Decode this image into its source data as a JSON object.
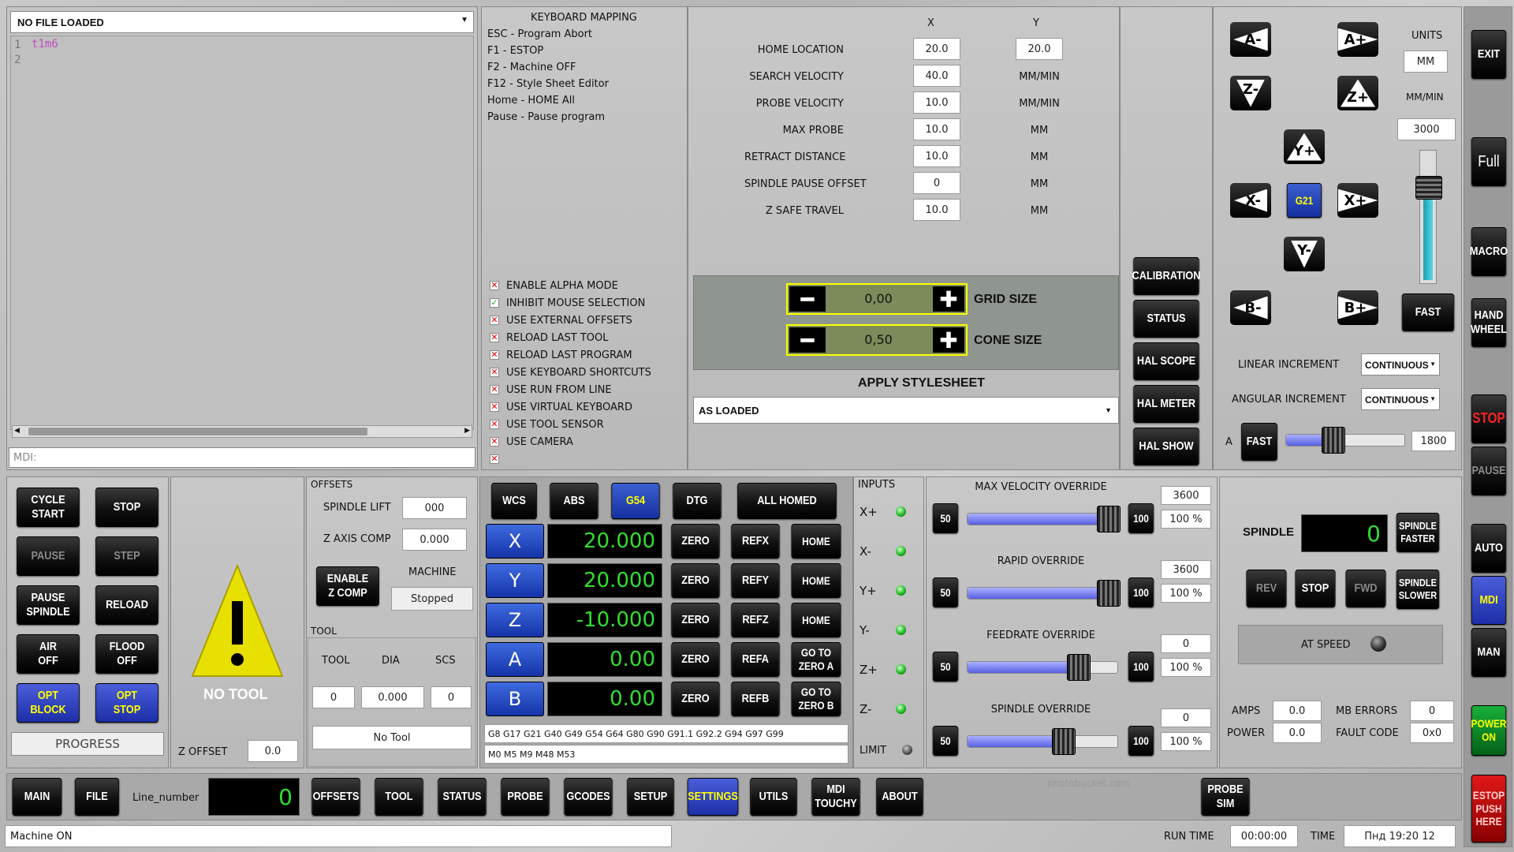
{
  "editor": {
    "file": "NO FILE LOADED",
    "lines": [
      "1",
      "2"
    ],
    "code": "t1m6",
    "mdi_placeholder": "MDI:"
  },
  "keymap": {
    "title": "KEYBOARD MAPPING",
    "items": [
      "ESC - Program Abort",
      "F1 - ESTOP",
      "F2 - Machine OFF",
      "F12 - Style Sheet Editor",
      "Home - HOME All",
      "Pause - Pause program"
    ]
  },
  "options": [
    {
      "label": "ENABLE ALPHA MODE",
      "checked": false
    },
    {
      "label": "INHIBIT MOUSE SELECTION",
      "checked": true
    },
    {
      "label": "USE EXTERNAL OFFSETS",
      "checked": false
    },
    {
      "label": "RELOAD LAST TOOL",
      "checked": false
    },
    {
      "label": "RELOAD LAST PROGRAM",
      "checked": false
    },
    {
      "label": "USE KEYBOARD SHORTCUTS",
      "checked": false
    },
    {
      "label": "USE RUN FROM LINE",
      "checked": false
    },
    {
      "label": "USE VIRTUAL KEYBOARD",
      "checked": false
    },
    {
      "label": "USE TOOL SENSOR",
      "checked": false
    },
    {
      "label": "USE CAMERA",
      "checked": false
    },
    {
      "label": "",
      "checked": false
    }
  ],
  "probe": {
    "col_x": "X",
    "col_y": "Y",
    "rows": [
      {
        "label": "HOME LOCATION",
        "x": "20.0",
        "y": "20.0",
        "unit": ""
      },
      {
        "label": "SEARCH VELOCITY",
        "x": "40.0",
        "y": "",
        "unit": "MM/MIN"
      },
      {
        "label": "PROBE VELOCITY",
        "x": "10.0",
        "y": "",
        "unit": "MM/MIN"
      },
      {
        "label": "MAX PROBE",
        "x": "10.0",
        "y": "",
        "unit": "MM"
      },
      {
        "label": "RETRACT DISTANCE",
        "x": "10.0",
        "y": "",
        "unit": "MM"
      },
      {
        "label": "SPINDLE PAUSE OFFSET",
        "x": "0",
        "y": "",
        "unit": "MM"
      },
      {
        "label": "Z SAFE TRAVEL",
        "x": "10.0",
        "y": "",
        "unit": "MM"
      }
    ]
  },
  "grid": {
    "grid_value": "0,00",
    "grid_label": "GRID SIZE",
    "cone_value": "0,50",
    "cone_label": "CONE SIZE",
    "stylesheet_label": "APPLY STYLESHEET",
    "stylesheet_value": "AS LOADED"
  },
  "utilbtns": [
    "CALIBRATION",
    "STATUS",
    "HAL SCOPE",
    "HAL METER",
    "HAL SHOW"
  ],
  "jog": {
    "units_label": "UNITS",
    "units": "MM",
    "rate_label": "MM/MIN",
    "rate": "3000",
    "g21": "G21",
    "fast": "FAST",
    "lin_label": "LINEAR INCREMENT",
    "lin": "CONTINUOUS",
    "ang_label": "ANGULAR INCREMENT",
    "ang": "CONTINUOUS",
    "a_label": "A",
    "a_fast": "FAST",
    "a_rate": "1800",
    "a_rate_frac": 0.4,
    "rate_frac": 0.75,
    "keys": {
      "am": "A-",
      "ap": "A+",
      "zm": "Z-",
      "zp": "Z+",
      "yp": "Y+",
      "xm": "X-",
      "xp": "X+",
      "ym": "Y-",
      "bm": "B-",
      "bp": "B+"
    }
  },
  "side": {
    "exit": "EXIT",
    "full": "Full",
    "macro": "MACRO",
    "hand": "HAND\nWHEEL",
    "stop": "STOP",
    "pause": "PAUSE",
    "auto": "AUTO",
    "mdi": "MDI",
    "man": "MAN",
    "power": "POWER\nON",
    "estop": "ESTOP\nPUSH\nHERE"
  },
  "run": {
    "cycle": "CYCLE\nSTART",
    "stop": "STOP",
    "pause": "PAUSE",
    "step": "STEP",
    "pspindle": "PAUSE\nSPINDLE",
    "reload": "RELOAD",
    "air": "AIR\nOFF",
    "flood": "FLOOD\nOFF",
    "optblock": "OPT\nBLOCK",
    "optstop": "OPT\nSTOP",
    "progress": "PROGRESS"
  },
  "tool": {
    "notool": "NO TOOL",
    "zoffset_label": "Z OFFSET",
    "zoffset": "0.0"
  },
  "offsets": {
    "title": "OFFSETS",
    "spindle_lift_label": "SPINDLE LIFT",
    "spindle_lift": "000",
    "zcomp_label": "Z AXIS COMP",
    "zcomp": "0.000",
    "enable": "ENABLE\nZ COMP",
    "machine_label": "MACHINE",
    "machine": "Stopped",
    "tool_title": "TOOL",
    "tool_h": "TOOL",
    "dia_h": "DIA",
    "scs_h": "SCS",
    "tool": "0",
    "dia": "0.000",
    "scs": "0",
    "desc": "No Tool"
  },
  "dro": {
    "wcs": "WCS",
    "abs": "ABS",
    "g54": "G54",
    "dtg": "DTG",
    "homed": "ALL HOMED",
    "axes": [
      {
        "name": "X",
        "value": "20.000",
        "ref": "REFX",
        "home": "HOME"
      },
      {
        "name": "Y",
        "value": "20.000",
        "ref": "REFY",
        "home": "HOME"
      },
      {
        "name": "Z",
        "value": "-10.000",
        "ref": "REFZ",
        "home": "HOME"
      },
      {
        "name": "A",
        "value": "0.00",
        "ref": "REFA",
        "home": "GO TO\nZERO A"
      },
      {
        "name": "B",
        "value": "0.00",
        "ref": "REFB",
        "home": "GO TO\nZERO B"
      }
    ],
    "zero": "ZERO",
    "gcodes": "G8 G17 G21 G40 G49 G54 G64 G80 G90 G91.1 G92.2 G94 G97 G99",
    "mcodes": "M0 M5 M9 M48 M53"
  },
  "inputs": {
    "title": "INPUTS",
    "items": [
      "X+",
      "X-",
      "Y+",
      "Y-",
      "Z+",
      "Z-"
    ],
    "limit": "LIMIT"
  },
  "overrides": [
    {
      "title": "MAX VELOCITY OVERRIDE",
      "value": "3600",
      "pct": "100 %",
      "frac": 1.0
    },
    {
      "title": "RAPID OVERRIDE",
      "value": "3600",
      "pct": "100 %",
      "frac": 1.0
    },
    {
      "title": "FEEDRATE OVERRIDE",
      "value": "0",
      "pct": "100 %",
      "frac": 0.8
    },
    {
      "title": "SPINDLE OVERRIDE",
      "value": "0",
      "pct": "100 %",
      "frac": 0.7
    }
  ],
  "ovr_btns": {
    "low": "50",
    "high": "100"
  },
  "spindle": {
    "label": "SPINDLE",
    "rpm": "0",
    "faster": "SPINDLE\nFASTER",
    "slower": "SPINDLE\nSLOWER",
    "rev": "REV",
    "stop": "STOP",
    "fwd": "FWD",
    "atspeed": "AT SPEED",
    "amps_label": "AMPS",
    "amps": "0.0",
    "power_label": "POWER",
    "power": "0.0",
    "mberr_label": "MB ERRORS",
    "mberr": "0",
    "fault_label": "FAULT CODE",
    "fault": "0x0"
  },
  "tabs": [
    "MAIN",
    "FILE",
    "OFFSETS",
    "TOOL",
    "STATUS",
    "PROBE",
    "GCODES",
    "SETUP",
    "SETTINGS",
    "UTILS",
    "MDI\nTOUCHY",
    "ABOUT"
  ],
  "active_tab": "SETTINGS",
  "line_number_label": "Line_number",
  "line_number": "0",
  "probe_sim": "PROBE\nSIM",
  "watermark": "photobucket.com",
  "status": {
    "message": "Machine ON",
    "run_label": "RUN TIME",
    "run": "00:00:00",
    "time_label": "TIME",
    "time": "Пнд 19:20 12"
  },
  "colors": {
    "dro_text": "#2fdf2f",
    "active_tab": "#2030b0",
    "active_text": "#ffff00"
  }
}
